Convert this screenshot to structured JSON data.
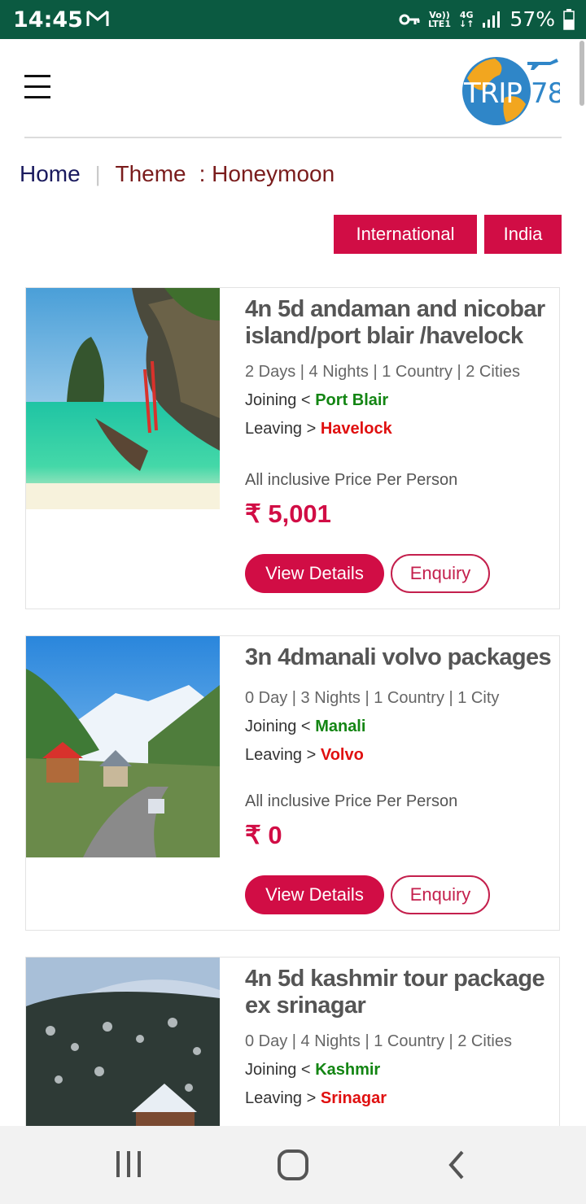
{
  "status_bar": {
    "time": "14:45",
    "battery": "57%",
    "signal_top": "Vo))",
    "signal_bottom": "LTE1",
    "network": "4G"
  },
  "breadcrumb": {
    "home": "Home",
    "separator": "|",
    "theme": "Theme",
    "current": ": Honeymoon"
  },
  "filters": [
    {
      "label": "International"
    },
    {
      "label": "India"
    }
  ],
  "packages": [
    {
      "title": "4n 5d andaman and nicobar island/port blair /havelock",
      "meta": "2 Days |  4 Nights |  1 Country | 2 Cities",
      "joining_label": "Joining <",
      "joining": "Port Blair",
      "leaving_label": "Leaving >",
      "leaving": "Havelock",
      "price_label": "All inclusive Price Per Person",
      "price": "₹ 5,001",
      "view_label": "View Details",
      "enquiry_label": "Enquiry"
    },
    {
      "title": "3n 4dmanali volvo packages",
      "meta": "0 Day |  3 Nights |  1 Country | 1 City",
      "joining_label": "Joining <",
      "joining": "Manali",
      "leaving_label": "Leaving >",
      "leaving": "Volvo",
      "price_label": "All inclusive Price Per Person",
      "price": "₹ 0",
      "view_label": "View Details",
      "enquiry_label": "Enquiry"
    },
    {
      "title": "4n 5d kashmir tour package ex srinagar",
      "meta": "0 Day |  4 Nights |  1 Country | 2 Cities",
      "joining_label": "Joining <",
      "joining": "Kashmir",
      "leaving_label": "Leaving >",
      "leaving": "Srinagar"
    }
  ],
  "colors": {
    "accent": "#d10d45",
    "status_bar": "#0b5a41",
    "joining": "#138513",
    "leaving": "#e01010"
  },
  "icons": {
    "menu": "hamburger-menu-icon",
    "logo": "trip78-logo",
    "back": "back-chevron-icon",
    "home": "home-icon",
    "recents": "recent-apps-icon"
  }
}
